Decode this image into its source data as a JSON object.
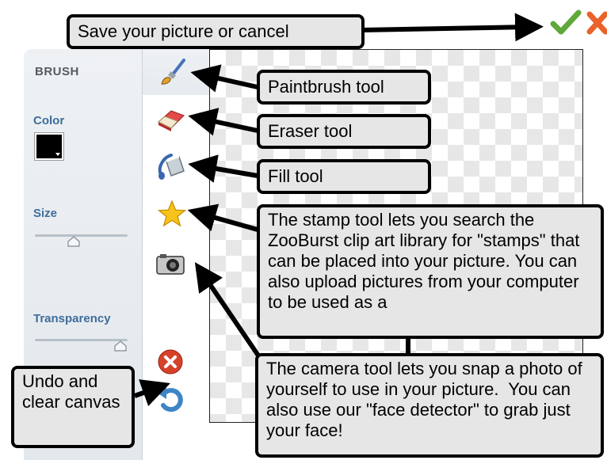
{
  "panel": {
    "title": "BRUSH",
    "color_label": "Color",
    "size_label": "Size",
    "transparency_label": "Transparency",
    "color_value": "#000000",
    "size_level": 0.4,
    "transparency_level": 1.0
  },
  "tools": [
    {
      "name": "paintbrush",
      "icon": "paintbrush-icon"
    },
    {
      "name": "eraser",
      "icon": "eraser-icon"
    },
    {
      "name": "fill",
      "icon": "fill-bucket-icon"
    },
    {
      "name": "stamp",
      "icon": "star-icon"
    },
    {
      "name": "camera",
      "icon": "camera-icon"
    },
    {
      "name": "clear",
      "icon": "clear-icon"
    },
    {
      "name": "undo",
      "icon": "undo-icon"
    }
  ],
  "actions": {
    "save_icon": "checkmark-icon",
    "cancel_icon": "x-icon"
  },
  "callouts": {
    "save": "Save your picture or cancel",
    "paintbrush": "Paintbrush tool",
    "eraser": "Eraser tool",
    "fill": "Fill tool",
    "stamp": "The stamp tool lets you search the ZooBurst clip art library for \"stamps\" that can be placed into your picture. You can also upload pictures from your computer to be used as a",
    "camera": "The camera tool lets you snap a photo of yourself to use in your picture.  You can also use our \"face detector\" to grab just your face!",
    "undo": "Undo and clear canvas"
  },
  "colors": {
    "label_blue": "#3e6d9c",
    "save_green": "#5fa83a",
    "cancel_orange": "#e8622a",
    "clear_red": "#d6412a",
    "undo_blue": "#3d85c6"
  }
}
